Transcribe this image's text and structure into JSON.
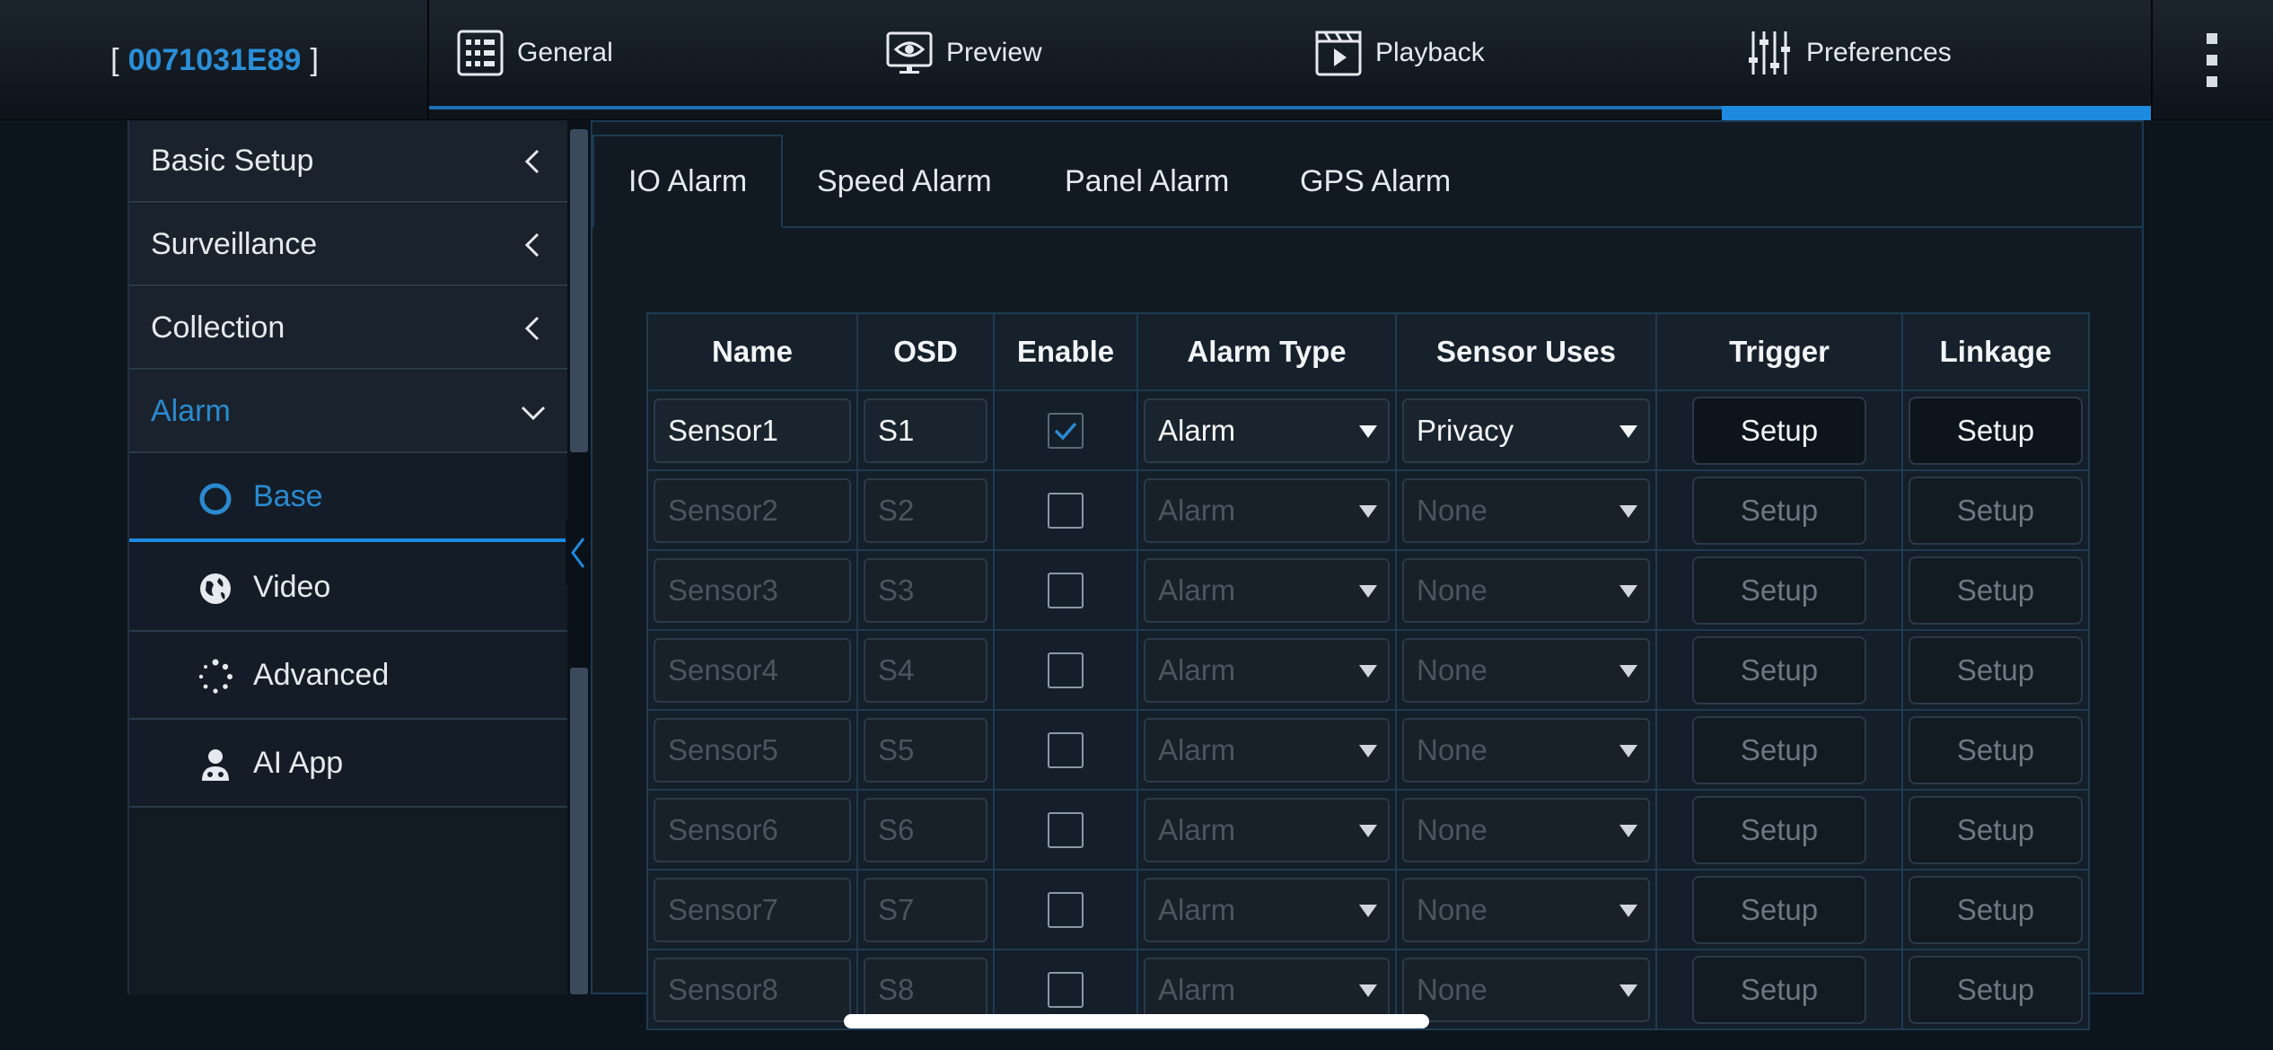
{
  "device": {
    "open_bracket": "[",
    "id": "0071031E89",
    "close_bracket": "]"
  },
  "nav": {
    "tabs": [
      {
        "label": "General",
        "icon": "grid-list-icon"
      },
      {
        "label": "Preview",
        "icon": "monitor-eye-icon"
      },
      {
        "label": "Playback",
        "icon": "clapper-play-icon"
      },
      {
        "label": "Preferences",
        "icon": "sliders-icon"
      }
    ],
    "active": "Preferences"
  },
  "sidebar": {
    "items": [
      {
        "label": "Basic Setup"
      },
      {
        "label": "Surveillance"
      },
      {
        "label": "Collection"
      },
      {
        "label": "Alarm"
      }
    ],
    "subitems": [
      {
        "label": "Base",
        "icon": "circle-icon"
      },
      {
        "label": "Video",
        "icon": "globe-icon"
      },
      {
        "label": "Advanced",
        "icon": "dotted-spinner-icon"
      },
      {
        "label": "AI App",
        "icon": "doctor-icon"
      }
    ]
  },
  "subtabs": [
    "IO Alarm",
    "Speed Alarm",
    "Panel Alarm",
    "GPS Alarm"
  ],
  "table": {
    "headers": [
      "Name",
      "OSD",
      "Enable",
      "Alarm Type",
      "Sensor Uses",
      "Trigger",
      "Linkage"
    ],
    "rows": [
      {
        "name": "Sensor1",
        "osd": "S1",
        "enabled": true,
        "alarm_type": "Alarm",
        "sensor_uses": "Privacy",
        "trigger": "Setup",
        "linkage": "Setup"
      },
      {
        "name": "Sensor2",
        "osd": "S2",
        "enabled": false,
        "alarm_type": "Alarm",
        "sensor_uses": "None",
        "trigger": "Setup",
        "linkage": "Setup"
      },
      {
        "name": "Sensor3",
        "osd": "S3",
        "enabled": false,
        "alarm_type": "Alarm",
        "sensor_uses": "None",
        "trigger": "Setup",
        "linkage": "Setup"
      },
      {
        "name": "Sensor4",
        "osd": "S4",
        "enabled": false,
        "alarm_type": "Alarm",
        "sensor_uses": "None",
        "trigger": "Setup",
        "linkage": "Setup"
      },
      {
        "name": "Sensor5",
        "osd": "S5",
        "enabled": false,
        "alarm_type": "Alarm",
        "sensor_uses": "None",
        "trigger": "Setup",
        "linkage": "Setup"
      },
      {
        "name": "Sensor6",
        "osd": "S6",
        "enabled": false,
        "alarm_type": "Alarm",
        "sensor_uses": "None",
        "trigger": "Setup",
        "linkage": "Setup"
      },
      {
        "name": "Sensor7",
        "osd": "S7",
        "enabled": false,
        "alarm_type": "Alarm",
        "sensor_uses": "None",
        "trigger": "Setup",
        "linkage": "Setup"
      },
      {
        "name": "Sensor8",
        "osd": "S8",
        "enabled": false,
        "alarm_type": "Alarm",
        "sensor_uses": "None",
        "trigger": "Setup",
        "linkage": "Setup"
      }
    ]
  },
  "colors": {
    "accent": "#2b8fd8",
    "background": "#0c141d",
    "panel": "#111a22",
    "border": "#1d3a52"
  }
}
